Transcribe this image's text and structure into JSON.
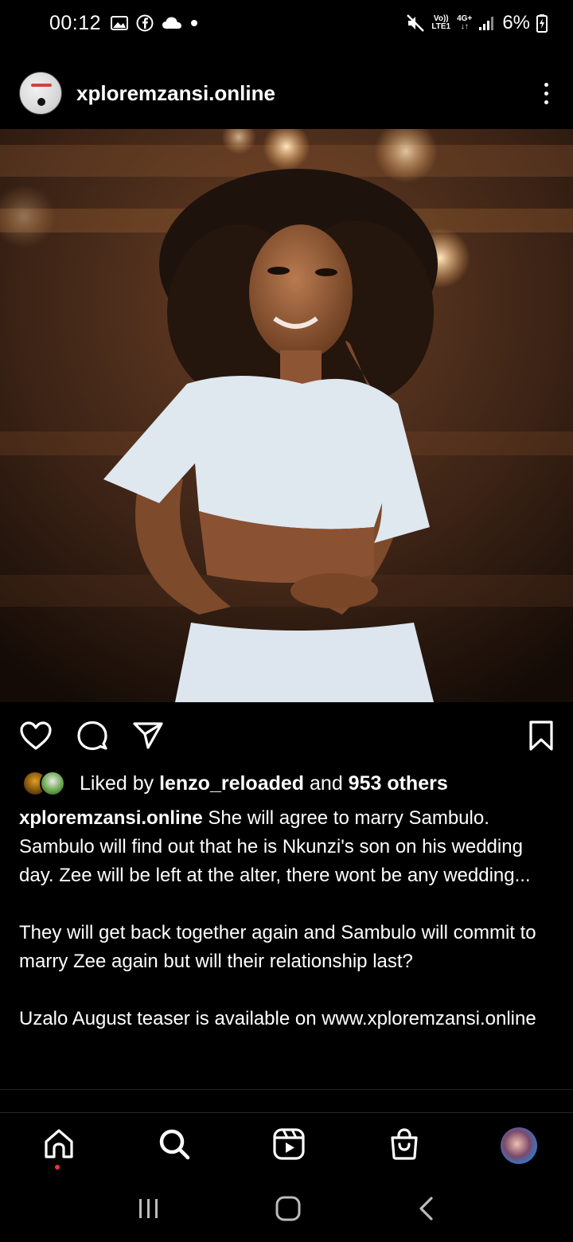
{
  "status_bar": {
    "time": "00:12",
    "network_top": "Vo))",
    "network_bottom": "LTE1",
    "data_type": "4G+",
    "battery": "6%"
  },
  "post": {
    "username": "xploremzansi.online",
    "photo_alt": "Woman in white crop top",
    "likes": {
      "prefix": "Liked by ",
      "liker": "lenzo_reloaded",
      "middle": " and ",
      "others": "953 others"
    },
    "caption": {
      "user": "xploremzansi.online",
      "para1": " She will agree to marry Sambulo. Sambulo will find out that he is Nkunzi's son on his wedding day. Zee will be left at the alter, there wont be any wedding...",
      "para2": "They will get back together again and Sambulo will commit to marry Zee again but will their relationship last?",
      "para3": "Uzalo August teaser is available on www.xploremzansi.online"
    }
  },
  "icons": {
    "like": "heart-icon",
    "comment": "comment-icon",
    "share": "send-icon",
    "save": "bookmark-icon"
  },
  "bottom_nav": [
    "home",
    "search",
    "reels",
    "shop",
    "profile"
  ],
  "colors": {
    "background": "#000000",
    "text": "#ffffff",
    "notification": "#ff3040"
  }
}
